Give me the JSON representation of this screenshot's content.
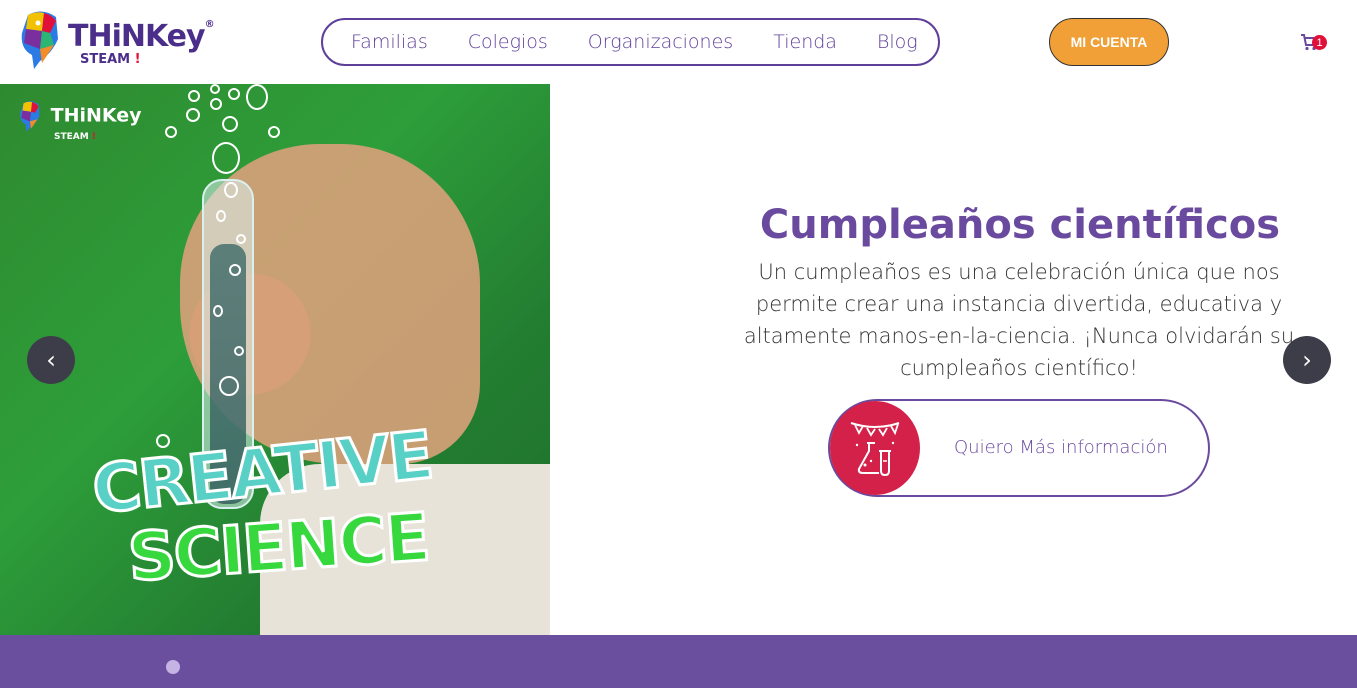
{
  "header": {
    "logo": {
      "brand": "THiNKey",
      "registered": "®",
      "sub": "STEAM",
      "sub_mark": "!"
    },
    "nav": [
      {
        "label": "Familias"
      },
      {
        "label": "Colegios"
      },
      {
        "label": "Organizaciones"
      },
      {
        "label": "Tienda"
      },
      {
        "label": "Blog"
      }
    ],
    "account_label": "MI CUENTA",
    "cart": {
      "icon": "cart-icon",
      "count": "1"
    }
  },
  "hero": {
    "image_logo": {
      "brand": "THiNKey",
      "sub": "STEAM",
      "sub_mark": "!"
    },
    "image_text_line1": "CREATIVE",
    "image_text_line2": "SCIENCE",
    "title": "Cumpleaños científicos",
    "description": "Un cumpleaños es una celebración única que nos permite crear una instancia divertida, educativa y altamente manos-en-la-ciencia. ¡Nunca olvidarán su cumpleaños científico!",
    "cta_label": "Quiero Más información",
    "cta_icon": "party-flask-icon",
    "prev": "‹",
    "next": "›"
  },
  "colors": {
    "purple": "#6a4a9e",
    "orange": "#f0a037",
    "red": "#d4214a",
    "band": "#6a4f9e"
  }
}
